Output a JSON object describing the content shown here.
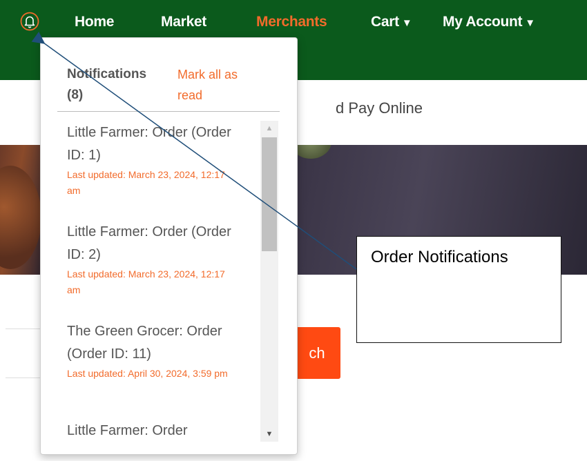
{
  "navbar": {
    "bell_icon": "bell-icon",
    "links": [
      {
        "label": "Home"
      },
      {
        "label": "Market"
      },
      {
        "label": "Merchants",
        "active": true
      },
      {
        "label": "Cart",
        "caret": "▼"
      },
      {
        "label": "My Account",
        "caret": "▼"
      }
    ]
  },
  "page": {
    "tagline_fragment": "d Pay Online",
    "search_button_fragment": "ch"
  },
  "notifications": {
    "title": "Notifications",
    "count": "(8)",
    "mark_all_label": "Mark all as read",
    "items": [
      {
        "title": "Little Farmer: Order (Order ID: 1)",
        "updated": "Last updated: March 23, 2024, 12:17 am"
      },
      {
        "title": "Little Farmer: Order (Order ID: 2)",
        "updated": "Last updated: March 23, 2024, 12:17 am"
      },
      {
        "title": "The Green Grocer: Order (Order ID: 11)",
        "updated": "Last updated: April 30, 2024, 3:59 pm"
      },
      {
        "title": "Little Farmer: Order",
        "updated": ""
      }
    ]
  },
  "callout": {
    "text": "Order Notifications"
  },
  "colors": {
    "navbar": "#0b5a1c",
    "accent": "#f26b2b",
    "search_button": "#ff4a12",
    "arrow": "#1f4e79"
  }
}
